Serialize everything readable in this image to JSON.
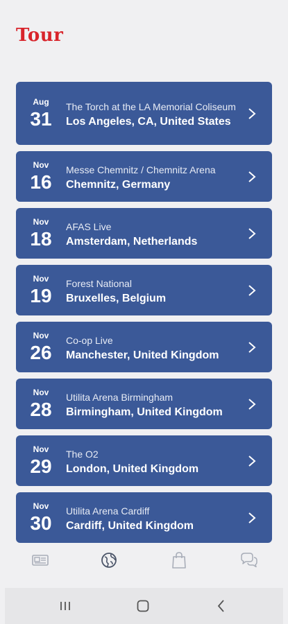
{
  "header": {
    "title": "Tour"
  },
  "events": [
    {
      "month": "Aug",
      "day": "31",
      "venue": "The Torch at the LA Memorial Coliseum",
      "city": "Los Angeles, CA, United States"
    },
    {
      "month": "Nov",
      "day": "16",
      "venue": "Messe Chemnitz / Chemnitz Arena",
      "city": "Chemnitz, Germany"
    },
    {
      "month": "Nov",
      "day": "18",
      "venue": "AFAS Live",
      "city": "Amsterdam, Netherlands"
    },
    {
      "month": "Nov",
      "day": "19",
      "venue": "Forest National",
      "city": "Bruxelles, Belgium"
    },
    {
      "month": "Nov",
      "day": "26",
      "venue": "Co-op Live",
      "city": "Manchester, United Kingdom"
    },
    {
      "month": "Nov",
      "day": "28",
      "venue": "Utilita Arena Birmingham",
      "city": "Birmingham, United Kingdom"
    },
    {
      "month": "Nov",
      "day": "29",
      "venue": "The O2",
      "city": "London, United Kingdom"
    },
    {
      "month": "Nov",
      "day": "30",
      "venue": "Utilita Arena Cardiff",
      "city": "Cardiff, United Kingdom"
    }
  ],
  "bottom_tabs": [
    {
      "icon": "news-icon"
    },
    {
      "icon": "globe-icon",
      "active": true
    },
    {
      "icon": "shopping-bag-icon"
    },
    {
      "icon": "chat-icon"
    }
  ],
  "colors": {
    "accent": "#d8242b",
    "card": "#3b5998",
    "background": "#f0f0f2"
  }
}
